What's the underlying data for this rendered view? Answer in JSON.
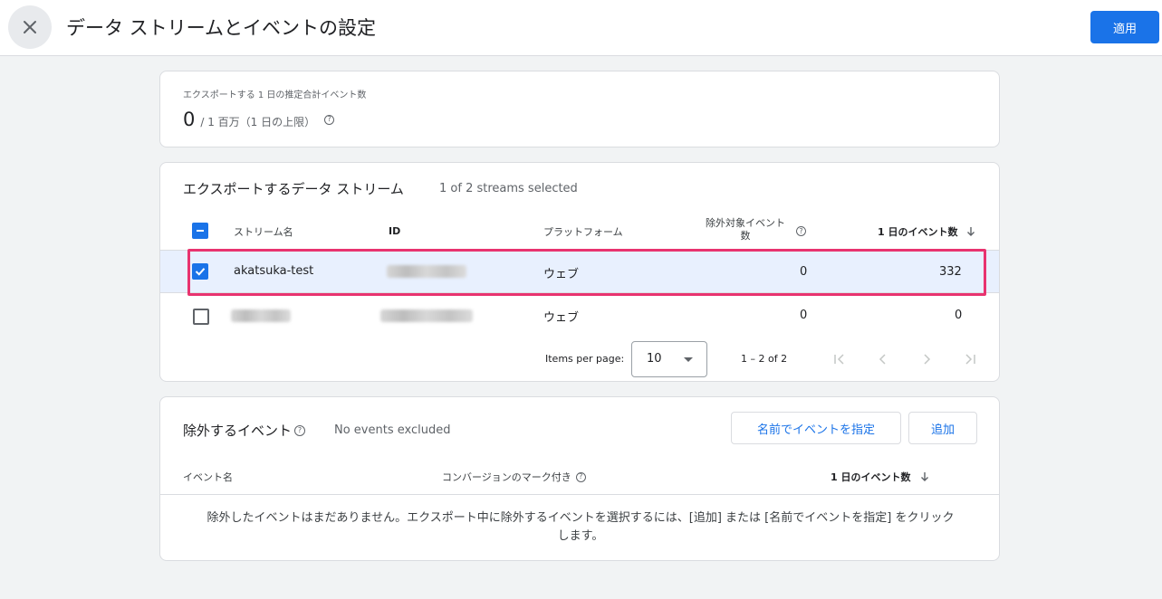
{
  "header": {
    "title": "データ ストリームとイベントの設定",
    "apply_label": "適用"
  },
  "summary": {
    "label": "エクスポートする 1 日の推定合計イベント数",
    "value": "0",
    "limit_text": "/ 1 百万（1 日の上限）"
  },
  "streams": {
    "title": "エクスポートするデータ ストリーム",
    "selection_status": "1 of 2 streams selected",
    "columns": {
      "name": "ストリーム名",
      "id": "ID",
      "platform": "プラットフォーム",
      "excluded_line1": "除外対象イベント",
      "excluded_line2": "数",
      "daily_events": "1 日のイベント数"
    },
    "rows": [
      {
        "name": "akatsuka-test",
        "platform": "ウェブ",
        "excluded": "0",
        "daily_events": "332",
        "checked": true
      },
      {
        "name": "",
        "platform": "ウェブ",
        "excluded": "0",
        "daily_events": "0",
        "checked": false
      }
    ],
    "pagination": {
      "items_per_page_label": "Items per page:",
      "page_size": "10",
      "range": "1 – 2 of 2"
    }
  },
  "excluded_events": {
    "title": "除外するイベント",
    "status": "No events excluded",
    "specify_button": "名前でイベントを指定",
    "add_button": "追加",
    "columns": {
      "event_name": "イベント名",
      "conversion": "コンバージョンのマーク付き",
      "daily_events": "1 日のイベント数"
    },
    "empty_line1": "除外したイベントはまだありません。エクスポート中に除外するイベントを選択するには、[追加] または [名前でイベントを指定] をクリック",
    "empty_line2": "します。"
  },
  "colors": {
    "primary": "#1a73e8",
    "highlight": "#e8336f",
    "selected_row": "#e8f0fe"
  },
  "icons": [
    "close-icon",
    "help-icon",
    "arrow-down-icon",
    "checkbox-indeterminate-icon",
    "checkbox-checked-icon",
    "dropdown-arrow-icon",
    "first-page-icon",
    "prev-page-icon",
    "next-page-icon",
    "last-page-icon"
  ]
}
